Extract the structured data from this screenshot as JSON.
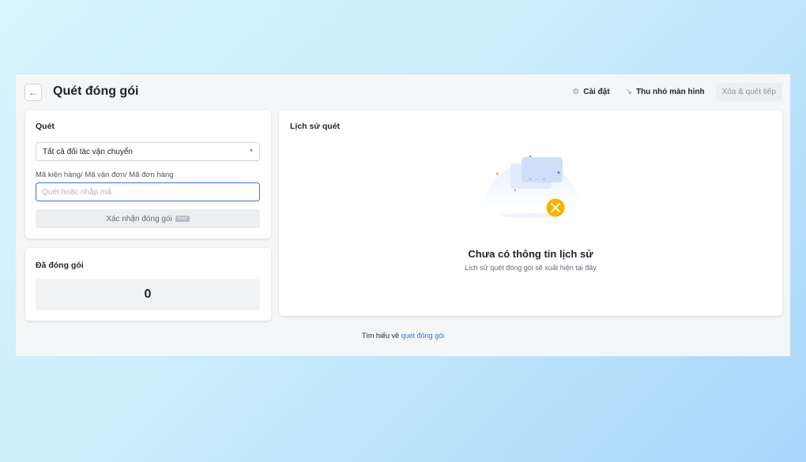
{
  "header": {
    "title": "Quét đóng gói",
    "settings_label": "Cài đặt",
    "minimize_label": "Thu nhỏ màn hình",
    "clear_label": "Xóa & quét tiếp"
  },
  "scan": {
    "title": "Quét",
    "carrier_selected": "Tất cả đối tác vận chuyển",
    "code_label": "Mã kiện hàng/ Mã vận đơn/ Mã đơn hàng",
    "code_placeholder": "Quét hoặc nhập mã",
    "confirm_label": "Xác nhận đóng gói",
    "confirm_key": "Enter"
  },
  "packed": {
    "title": "Đã đóng gói",
    "count": "0"
  },
  "history": {
    "title": "Lịch sử quét",
    "empty_title": "Chưa có thông tin lịch sử",
    "empty_subtitle": "Lịch sử quét đóng gói sẽ xuất hiện tại đây"
  },
  "footer": {
    "prefix": "Tìm hiểu về",
    "link": "quét đóng gói"
  },
  "colors": {
    "accent": "#3573e3",
    "badge": "#f5b400"
  }
}
